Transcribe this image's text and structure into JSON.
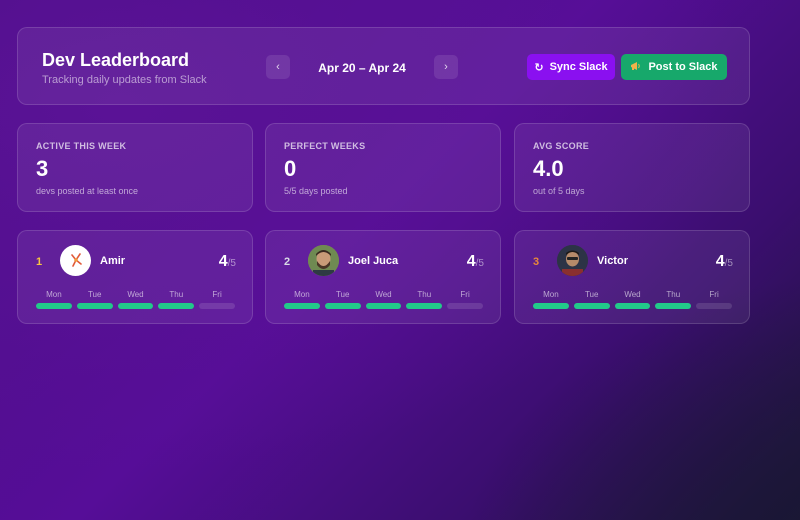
{
  "header": {
    "title": "Dev Leaderboard",
    "subtitle": "Tracking daily updates from Slack",
    "prev_icon": "chevron-left-icon",
    "prev_glyph": "‹",
    "next_icon": "chevron-right-icon",
    "next_glyph": "›",
    "week_range": "Apr 20 – Apr 24",
    "sync_label": "Sync Slack",
    "sync_glyph": "↻",
    "post_label": "Post to Slack",
    "post_glyph": "✉",
    "colors": {
      "sync": "#8a10f0",
      "post": "#17a86b"
    }
  },
  "stats": [
    {
      "label": "ACTIVE THIS WEEK",
      "value": "3",
      "note": "devs posted at least once"
    },
    {
      "label": "PERFECT WEEKS",
      "value": "0",
      "note": "5/5 days posted"
    },
    {
      "label": "AVG SCORE",
      "value": "4.0",
      "note": "out of 5 days"
    }
  ],
  "day_labels": [
    "Mon",
    "Tue",
    "Wed",
    "Thu",
    "Fri"
  ],
  "devs": [
    {
      "rank": "1",
      "rank_color": "#f5c542",
      "name": "Amir",
      "score": "4",
      "score_max": "/5",
      "days_posted": [
        true,
        true,
        true,
        true,
        false
      ]
    },
    {
      "rank": "2",
      "rank_color": "#d9dbe6",
      "name": "Joel Juca",
      "score": "4",
      "score_max": "/5",
      "days_posted": [
        true,
        true,
        true,
        true,
        false
      ]
    },
    {
      "rank": "3",
      "rank_color": "#e8883a",
      "name": "Victor",
      "score": "4",
      "score_max": "/5",
      "days_posted": [
        true,
        true,
        true,
        true,
        false
      ]
    }
  ],
  "colors": {
    "posted": "#22c98a",
    "missed": "rgba(255,255,255,0.12)"
  }
}
